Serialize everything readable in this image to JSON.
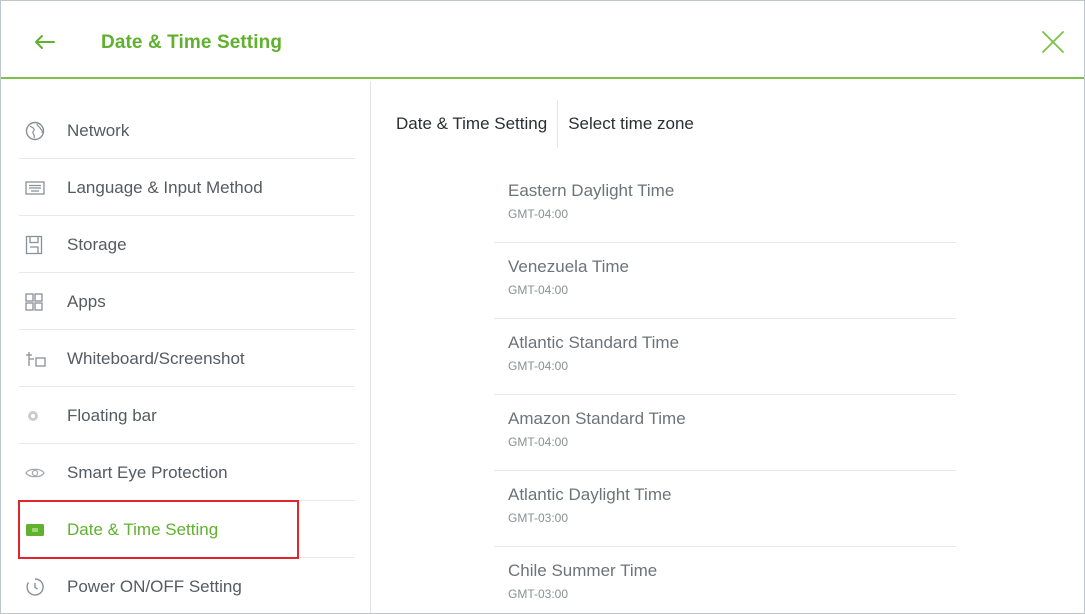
{
  "header": {
    "title": "Date & Time Setting"
  },
  "sidebar": {
    "items": [
      {
        "label": "Network",
        "icon": "globe-icon"
      },
      {
        "label": "Language & Input Method",
        "icon": "keyboard-icon"
      },
      {
        "label": "Storage",
        "icon": "storage-icon"
      },
      {
        "label": "Apps",
        "icon": "apps-grid-icon"
      },
      {
        "label": "Whiteboard/Screenshot",
        "icon": "whiteboard-icon"
      },
      {
        "label": "Floating bar",
        "icon": "gear-icon"
      },
      {
        "label": "Smart Eye Protection",
        "icon": "eye-icon"
      },
      {
        "label": "Date & Time Setting",
        "icon": "calendar-icon",
        "active": true
      },
      {
        "label": "Power ON/OFF Setting",
        "icon": "timer-icon"
      }
    ]
  },
  "main": {
    "breadcrumb": [
      "Date & Time Setting",
      "Select time zone"
    ],
    "timezones": [
      {
        "name": "Eastern Daylight Time",
        "offset": "GMT-04:00"
      },
      {
        "name": "Venezuela Time",
        "offset": "GMT-04:00"
      },
      {
        "name": "Atlantic Standard Time",
        "offset": "GMT-04:00"
      },
      {
        "name": "Amazon Standard Time",
        "offset": "GMT-04:00"
      },
      {
        "name": "Atlantic Daylight Time",
        "offset": "GMT-03:00"
      },
      {
        "name": "Chile Summer Time",
        "offset": "GMT-03:00"
      }
    ]
  },
  "colors": {
    "accent": "#5fb12e",
    "highlight": "#e0252d"
  }
}
